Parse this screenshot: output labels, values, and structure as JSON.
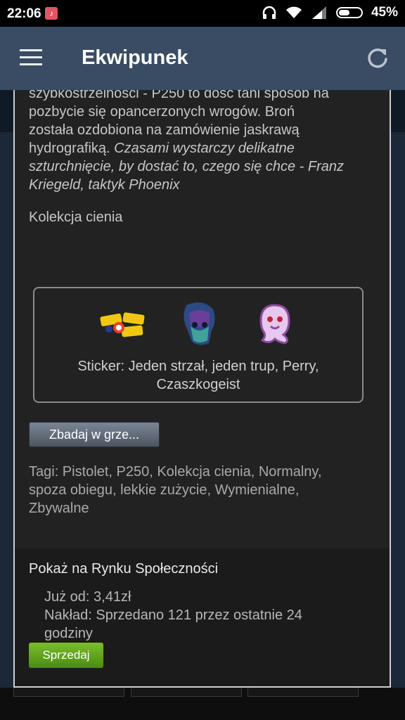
{
  "status_bar": {
    "time": "22:06",
    "battery": "45%",
    "battery_level": 0.45,
    "icons": [
      "tiktok-notification-icon",
      "headphones-icon",
      "wifi-icon",
      "signal-icon",
      "battery-icon"
    ]
  },
  "app_bar": {
    "title": "Ekwipunek",
    "menu_icon": "hamburger-menu-icon",
    "refresh_icon": "refresh-icon"
  },
  "item": {
    "description_line1": "szybkostrzelności - P250 to dość tani sposób na",
    "description_line2": "pozbycie się opancerzonych wrogów. Broń",
    "description_line3": "została ozdobiona na zamówienie jaskrawą",
    "description_line4_plain": "hydrografiką. ",
    "description_line4_italic": "Czasami wystarczy delikatne",
    "description_line5_italic": "szturchnięcie, by dostać to, czego się chce - Franz",
    "description_line6_italic": "Kriegeld, taktyk Phoenix",
    "collection": "Kolekcja cienia",
    "stickers": {
      "label_line1": "Sticker: Jeden strzał, jeden trup, Perry,",
      "label_line2": "Czaszkogeist",
      "items": [
        "one-shot-one-kill-sticker",
        "perry-sticker",
        "czaszkogeist-sticker"
      ]
    },
    "inspect_button": "Zbadaj w grze...",
    "tags_line1": "Tagi: Pistolet, P250, Kolekcja cienia, Normalny,",
    "tags_line2": "spoza obiegu, lekkie zużycie, Wymienialne,",
    "tags_line3": "Zbywalne"
  },
  "market": {
    "title": "Pokaż na Rynku Społeczności",
    "price": "Już od: 3,41zł",
    "volume_line1": "Nakład: Sprzedano 121 przez ostatnie 24",
    "volume_line2": "godziny",
    "sell_button": "Sprzedaj"
  },
  "colors": {
    "app_bar": "#394c63",
    "card_bg": "#222222",
    "sell_green": "#5c9e1b"
  }
}
